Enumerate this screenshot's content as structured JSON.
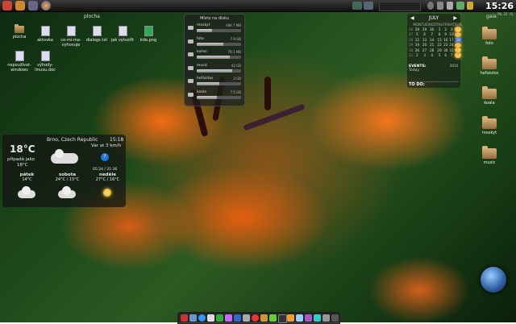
{
  "panel": {
    "clock": "15:26",
    "date": "Pá, 31. říj",
    "launcher_icons": [
      "home-icon",
      "files-icon",
      "monitor-icon",
      "firefox-icon"
    ],
    "tasks": [
      "terminal-icon",
      "window-icon"
    ]
  },
  "desktop": {
    "title": "plocha",
    "icons": [
      {
        "label": "plocha",
        "type": "folder"
      },
      {
        "label": "aktovka",
        "type": "doc"
      },
      {
        "label": "co-mi-ma-vyhovuje",
        "type": "doc"
      },
      {
        "label": "dialogs txt",
        "type": "doc"
      },
      {
        "label": "jak vytvořit",
        "type": "doc"
      },
      {
        "label": "kde.png",
        "type": "image"
      },
      {
        "label": "nepoužívat-windows",
        "type": "doc"
      },
      {
        "label": "výhody-linuxu.doc",
        "type": "doc"
      }
    ]
  },
  "disk": {
    "title": "Místo na disku",
    "items": [
      {
        "name": "moskyt",
        "size": "484.7 MB",
        "fill": 0.35
      },
      {
        "name": "foto",
        "size": "7.9 GB",
        "fill": 0.6
      },
      {
        "name": "kořen",
        "size": "79.1 MB",
        "fill": 0.75
      },
      {
        "name": "music",
        "size": "42 GB",
        "fill": 0.8
      },
      {
        "name": "hefaistos",
        "size": "3 GB",
        "fill": 0.5
      },
      {
        "name": "koala",
        "size": "7.5 GB",
        "fill": 0.45
      }
    ]
  },
  "calendar": {
    "month": "JULY",
    "year": "2010",
    "weekdays": [
      "MON",
      "TUE",
      "WED",
      "THU",
      "FRI",
      "SAT",
      "SUN"
    ],
    "weeks": [
      {
        "wk": "26",
        "days": [
          "28",
          "29",
          "30",
          "1",
          "2",
          "3",
          "4"
        ]
      },
      {
        "wk": "27",
        "days": [
          "5",
          "6",
          "7",
          "8",
          "9",
          "10",
          "11"
        ]
      },
      {
        "wk": "28",
        "days": [
          "12",
          "13",
          "14",
          "15",
          "16",
          "17",
          "18"
        ]
      },
      {
        "wk": "29",
        "days": [
          "19",
          "20",
          "21",
          "22",
          "23",
          "24",
          "25"
        ]
      },
      {
        "wk": "30",
        "days": [
          "26",
          "27",
          "28",
          "29",
          "30",
          "31",
          "1"
        ]
      },
      {
        "wk": "31",
        "days": [
          "2",
          "3",
          "4",
          "5",
          "6",
          "7",
          "8"
        ]
      }
    ],
    "today": "18",
    "events_label": "EVENTS:",
    "events_today": "Today",
    "todo_label": "TO DO:"
  },
  "weather": {
    "location": "Brno, Czech Republic",
    "time": "15:18",
    "temp": "18°C",
    "feels_label": "připadá jako",
    "feels_temp": "18°C",
    "wind": "Var at 3 km/h",
    "sunrise_sunset": "05:24 / 21:36",
    "forecast": [
      {
        "day": "pátek",
        "temps": "14°C",
        "icon": "rain-icon"
      },
      {
        "day": "sobota",
        "temps": "24°C / 15°C",
        "icon": "rain-icon"
      },
      {
        "day": "neděle",
        "temps": "27°C / 16°C",
        "icon": "sun-icon"
      }
    ]
  },
  "right_desktop": {
    "title": "gaia",
    "folders": [
      "foto",
      "hefaistos",
      "koala",
      "moskyt",
      "music"
    ]
  }
}
